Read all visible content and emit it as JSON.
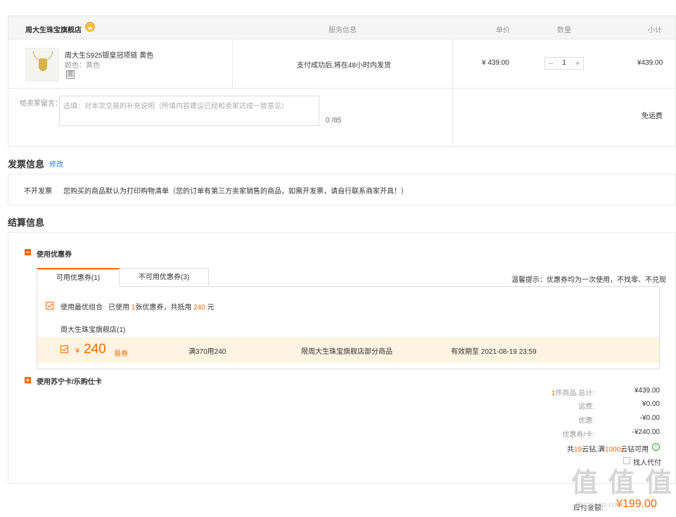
{
  "order": {
    "shop_name": "周大生珠宝旗舰店",
    "columns": {
      "service": "服务信息",
      "unit_price": "单价",
      "quantity": "数量",
      "subtotal": "小计"
    },
    "product": {
      "title": "周大生S925银皇冠项链 黄色",
      "color": "颜色：黄色",
      "tag": "圆",
      "service_info": "支付成功后,将在48小时内发货",
      "price": "¥ 439.00",
      "qty": "1",
      "qty_minus": "−",
      "qty_plus": "+",
      "subtotal": "¥439.00"
    },
    "message": {
      "label": "给卖家留言：",
      "placeholder": "选填：对本次交易的补充说明（所填内容建议已经和卖家达成一致意见）",
      "count": "0 /85",
      "shipping": "免运费"
    }
  },
  "invoice": {
    "title": "发票信息",
    "modify": "修改",
    "type": "不开发票",
    "desc": "您购买的商品默认为打印购物清单（您的订单有第三方卖家销售的商品，如需开发票，请自行联系商家开具！）"
  },
  "settlement": {
    "title": "结算信息",
    "use_coupon": "使用优惠券",
    "tabs": [
      {
        "label": "可用优惠券(1)"
      },
      {
        "label": "不可用优惠券(3)"
      }
    ],
    "tip": "温馨提示：优惠券均为一次使用，不找零、不兑现",
    "best_combo": {
      "label": "使用最优组合",
      "desc_prefix": "已使用",
      "count": "1",
      "desc_mid": "张优惠券，共抵用",
      "amount": "240",
      "desc_suffix": "元"
    },
    "coupon_shop": "周大生珠宝旗舰店(1)",
    "coupon": {
      "currency": "¥",
      "value": "240",
      "kind": "易券",
      "rule": "满370用240",
      "scope": "限周大生珠宝旗舰店部分商品",
      "expiry": "有效期至 2021-08-19 23:59"
    },
    "use_card": "使用苏宁卡/乐购仕卡"
  },
  "summary": {
    "items_count": "1",
    "items_label": "件商品 总计:",
    "items_total": "¥439.00",
    "shipping_label": "运费:",
    "shipping": "¥0.00",
    "discount_label": "优惠:",
    "discount": "-¥0.00",
    "coupon_label": "优惠券/卡:",
    "coupon": "-¥240.00",
    "points_prefix": "共",
    "points_have": "19",
    "points_mid": "云钻,满",
    "points_need": "1000",
    "points_suffix": "云钻可用",
    "proxy_pay": "找人代付",
    "payable_label": "应付金额:",
    "payable": "¥199.00"
  },
  "watermark": {
    "glyphs": "值 值 值",
    "site": "zhidecao.com"
  }
}
